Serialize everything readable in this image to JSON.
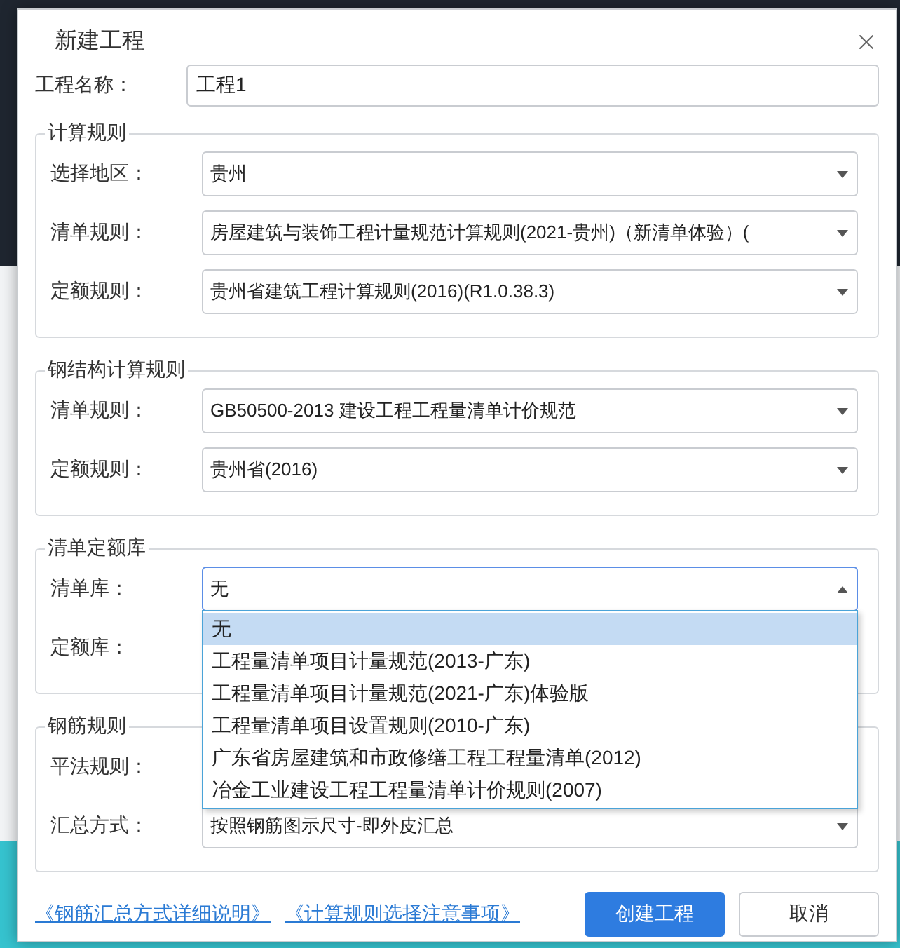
{
  "window": {
    "title": "新建工程"
  },
  "project_name": {
    "label": "工程名称：",
    "value": "工程1"
  },
  "groups": [
    {
      "title": "计算规则",
      "rows": [
        {
          "label": "选择地区：",
          "value": "贵州",
          "open": false
        },
        {
          "label": "清单规则：",
          "value": "房屋建筑与装饰工程计量规范计算规则(2021-贵州)（新清单体验）(",
          "open": false
        },
        {
          "label": "定额规则：",
          "value": "贵州省建筑工程计算规则(2016)(R1.0.38.3)",
          "open": false
        }
      ]
    },
    {
      "title": "钢结构计算规则",
      "rows": [
        {
          "label": "清单规则：",
          "value": "GB50500-2013 建设工程工程量清单计价规范",
          "open": false
        },
        {
          "label": "定额规则：",
          "value": "贵州省(2016)",
          "open": false
        }
      ]
    },
    {
      "title": "清单定额库",
      "rows": [
        {
          "label": "清单库：",
          "value": "无",
          "open": true,
          "options": [
            {
              "label": "无",
              "selected": true
            },
            {
              "label": "工程量清单项目计量规范(2013-广东)",
              "selected": false
            },
            {
              "label": "工程量清单项目计量规范(2021-广东)体验版",
              "selected": false
            },
            {
              "label": "工程量清单项目设置规则(2010-广东)",
              "selected": false
            },
            {
              "label": "广东省房屋建筑和市政修缮工程工程量清单(2012)",
              "selected": false
            },
            {
              "label": "冶金工业建设工程工程量清单计价规则(2007)",
              "selected": false
            }
          ]
        },
        {
          "label": "定额库："
        }
      ]
    },
    {
      "title": "钢筋规则",
      "rows": [
        {
          "label": "平法规则："
        },
        {
          "label": "汇总方式：",
          "value": "按照钢筋图示尺寸-即外皮汇总",
          "open": false
        }
      ]
    }
  ],
  "links": [
    "《钢筋汇总方式详细说明》",
    "《计算规则选择注意事项》"
  ],
  "buttons": [
    {
      "label": "创建工程",
      "kind": "primary"
    },
    {
      "label": "取消",
      "kind": "default"
    }
  ]
}
